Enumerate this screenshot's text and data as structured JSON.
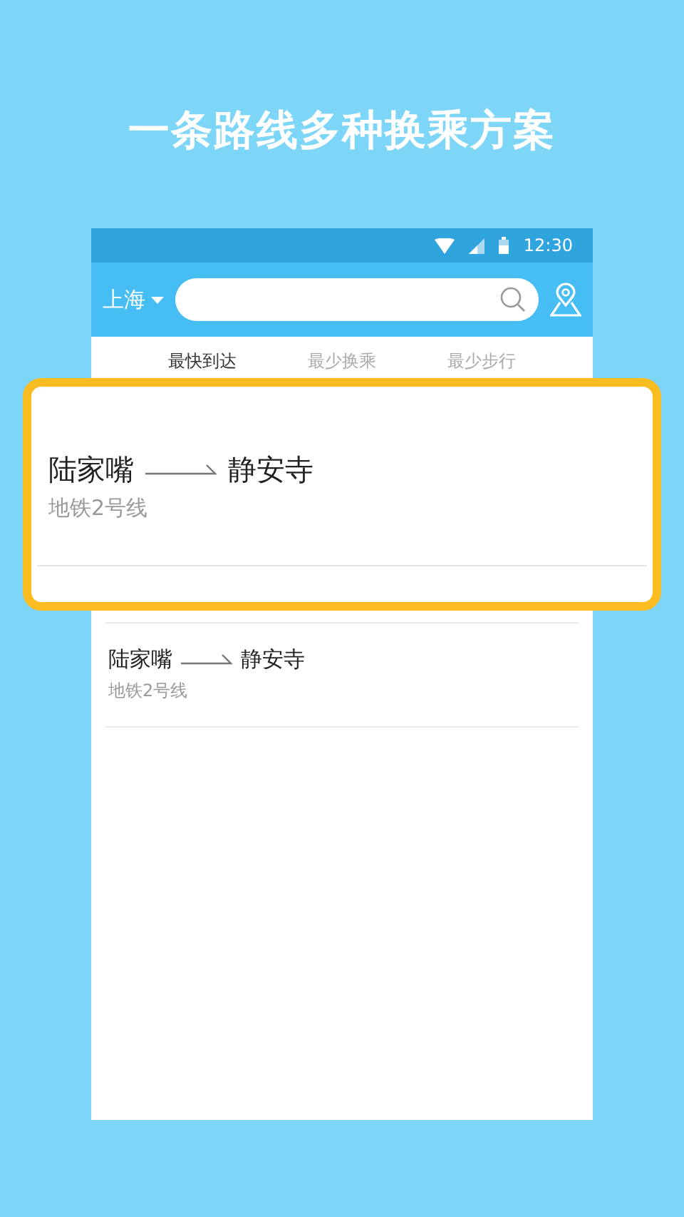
{
  "headline": "一条路线多种换乘方案",
  "status_bar": {
    "time": "12:30"
  },
  "toolbar": {
    "city": "上海"
  },
  "tabs": [
    {
      "label": "最快到达",
      "selected": true
    },
    {
      "label": "最少换乘",
      "selected": false
    },
    {
      "label": "最少步行",
      "selected": false
    }
  ],
  "highlighted_route": {
    "from": "陆家嘴",
    "to": "静安寺",
    "line": "地铁2号线"
  },
  "routes": [
    {
      "from": "陆家嘴",
      "to": "静安寺",
      "line": "地铁2号线"
    }
  ]
}
